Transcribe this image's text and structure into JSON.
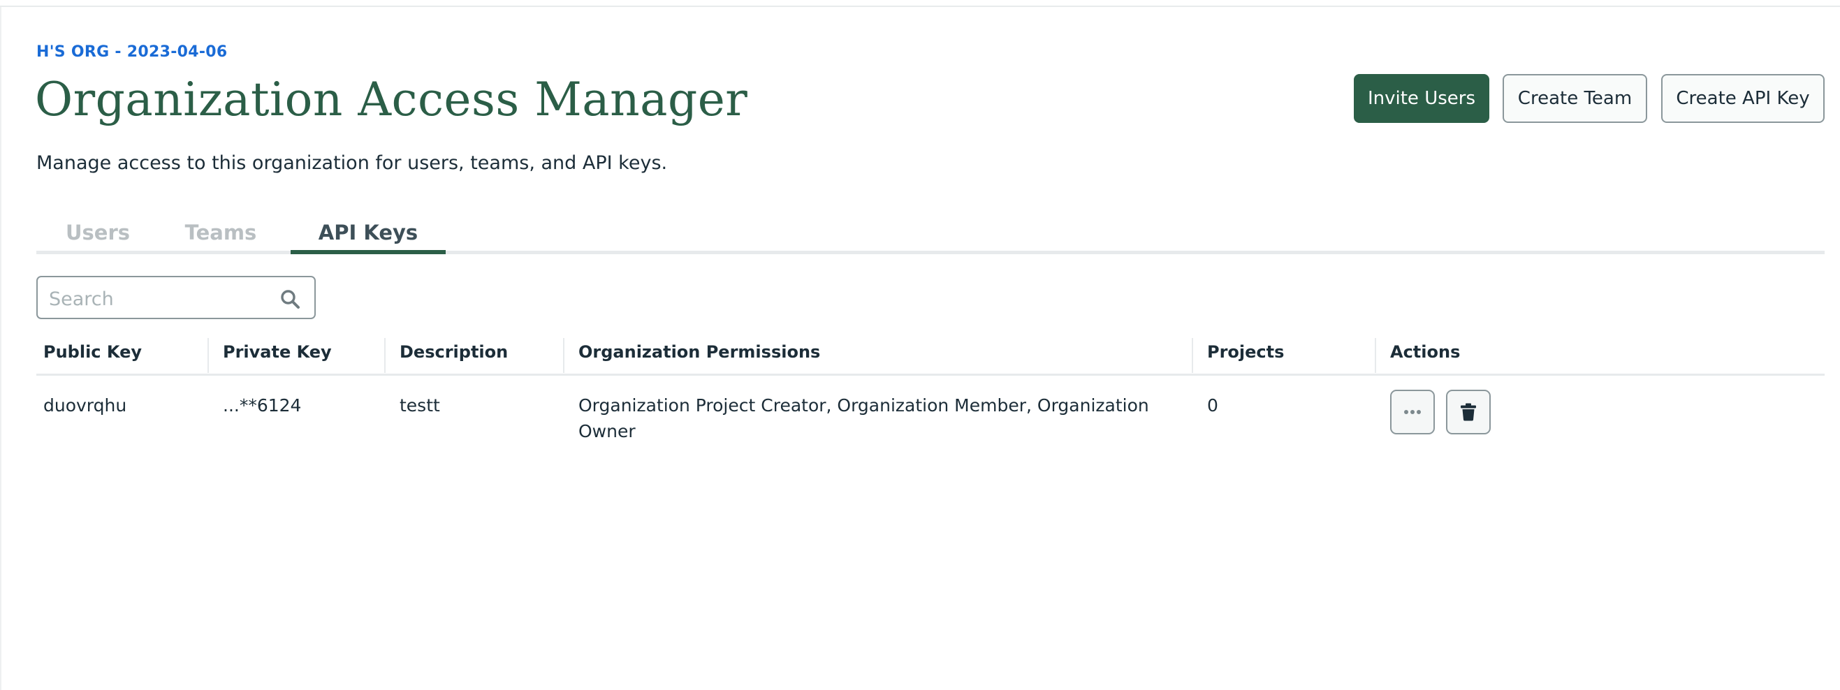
{
  "org": {
    "label": "H'S ORG - 2023-04-06"
  },
  "header": {
    "title": "Organization Access Manager",
    "subtitle": "Manage access to this organization for users, teams, and API keys."
  },
  "actions": {
    "invite_users": "Invite Users",
    "create_team": "Create Team",
    "create_api_key": "Create API Key"
  },
  "tabs": [
    {
      "label": "Users",
      "active": false
    },
    {
      "label": "Teams",
      "active": false
    },
    {
      "label": "API Keys",
      "active": true
    }
  ],
  "search": {
    "placeholder": "Search",
    "value": "",
    "icon": "search-icon"
  },
  "table": {
    "columns": [
      "Public Key",
      "Private Key",
      "Description",
      "Organization Permissions",
      "Projects",
      "Actions"
    ],
    "rows": [
      {
        "public_key": "duovrqhu",
        "private_key": "...**6124",
        "description": "testt",
        "permissions": "Organization Project Creator, Organization Member, Organization Owner",
        "projects": "0",
        "action_icons": [
          "ellipsis-icon",
          "trash-icon"
        ]
      }
    ]
  },
  "colors": {
    "accent": "#2b5e47",
    "org_label": "#1a6bd6",
    "text": "#1c2d38",
    "tab_inactive": "#b9bfc2"
  }
}
